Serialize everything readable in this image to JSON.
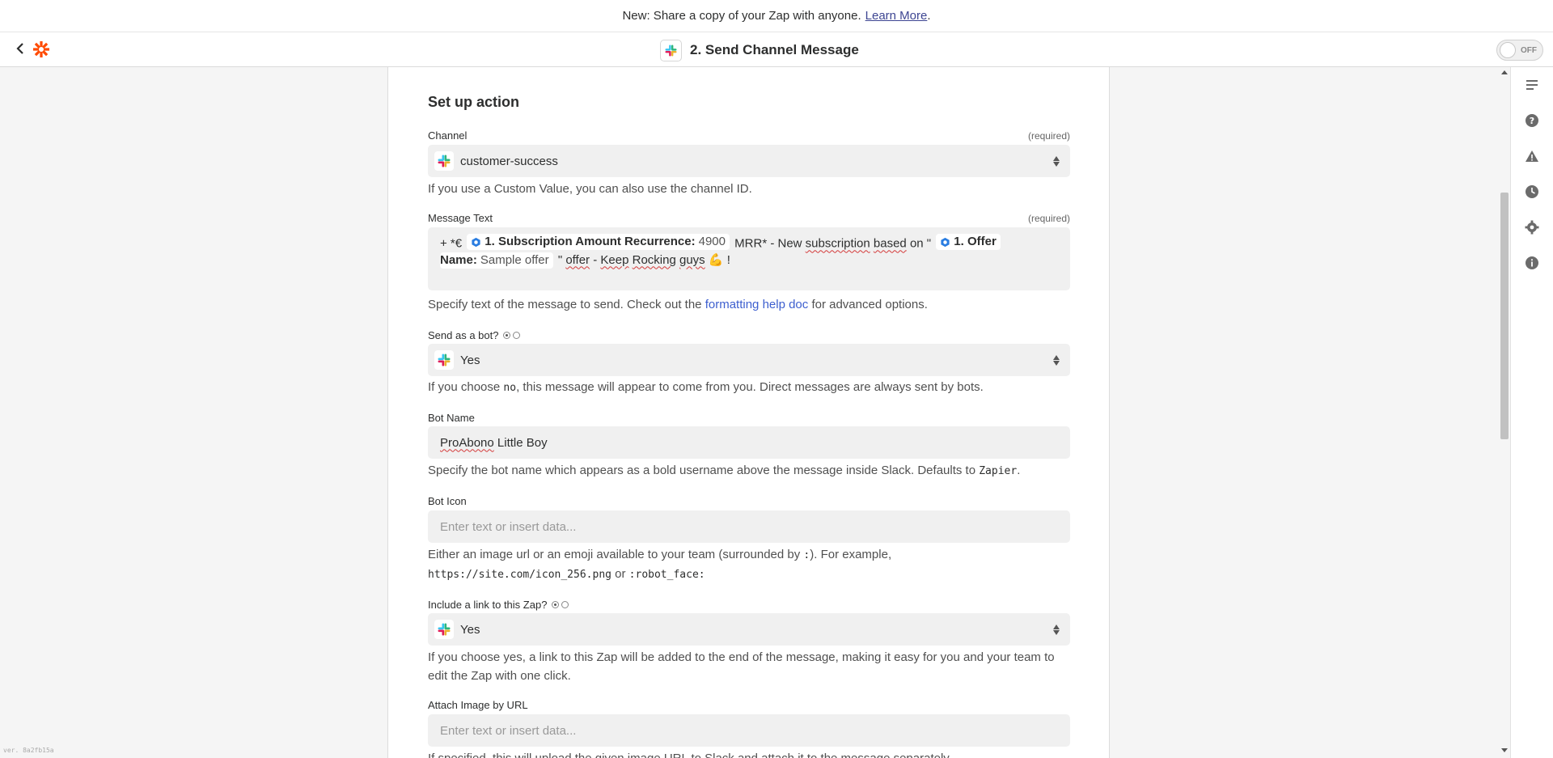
{
  "announcement": {
    "text": "New: Share a copy of your Zap with anyone.",
    "link": "Learn More",
    "suffix": "."
  },
  "header": {
    "step_title": "2. Send Channel Message",
    "toggle_label": "OFF"
  },
  "form": {
    "section_title": "Set up action",
    "required_text": "(required)",
    "channel": {
      "label": "Channel",
      "value": "customer-success",
      "help": "If you use a Custom Value, you can also use the channel ID."
    },
    "message_text": {
      "label": "Message Text",
      "prefix": "+ *€",
      "pill1_key": "1. Subscription Amount Recurrence:",
      "pill1_value": "4900",
      "mid1": "MRR* - New",
      "mid_word1": "subscription",
      "mid_word2": "based",
      "mid2": "on \"",
      "pill2_key": "1. Offer",
      "pill2_key_line2": "Name:",
      "pill2_value": "Sample offer",
      "end1": "\"",
      "end_word1": "offer",
      "end_dash": "-",
      "end_word2": "Keep",
      "end_word3": "Rocking",
      "end_word4": "guys",
      "emoji": "💪",
      "end_bang": "!",
      "help_before": "Specify text of the message to send. Check out the",
      "help_link": "formatting help doc",
      "help_after": "for advanced options."
    },
    "send_as_bot": {
      "label": "Send as a bot?",
      "value": "Yes",
      "help_before": "If you choose",
      "help_code": "no",
      "help_after": ", this message will appear to come from you. Direct messages are always sent by bots."
    },
    "bot_name": {
      "label": "Bot Name",
      "value_word1": "ProAbono",
      "value_rest": "Little Boy",
      "help_before": "Specify the bot name which appears as a bold username above the message inside Slack. Defaults to",
      "help_code": "Zapier",
      "help_after": "."
    },
    "bot_icon": {
      "label": "Bot Icon",
      "placeholder": "Enter text or insert data...",
      "help_before": "Either an image url or an emoji available to your team (surrounded by",
      "help_code1": ":",
      "help_mid": "). For example,",
      "help_code2": "https://site.com/icon_256.png",
      "help_or": "or",
      "help_code3": ":robot_face:"
    },
    "include_link": {
      "label": "Include a link to this Zap?",
      "value": "Yes",
      "help": "If you choose yes, a link to this Zap will be added to the end of the message, making it easy for you and your team to edit the Zap with one click."
    },
    "attach_image": {
      "label": "Attach Image by URL",
      "placeholder": "Enter text or insert data...",
      "help": "If specified, this will upload the given image URL to Slack and attach it to the message separately."
    }
  },
  "footer": {
    "version": "ver. 8a2fb15a"
  },
  "colors": {
    "zapier_orange": "#ff4a00",
    "link_blue": "#3d5fcf"
  },
  "icons": [
    "chevron-left-icon",
    "zapier-logo",
    "slack-icon",
    "notes-icon",
    "help-icon",
    "warning-icon",
    "history-icon",
    "settings-icon",
    "info-icon"
  ]
}
